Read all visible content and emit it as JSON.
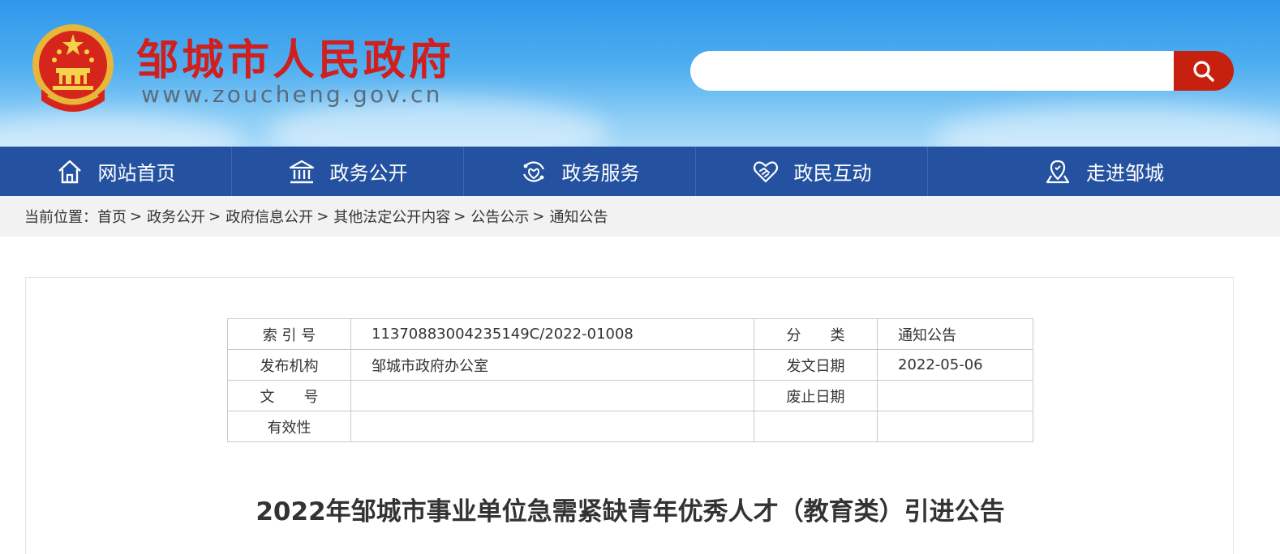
{
  "header": {
    "site_name": "邹城市人民政府",
    "site_url": "www.zoucheng.gov.cn",
    "search": {
      "value": "",
      "placeholder": ""
    },
    "colors": {
      "title": "#cf1f1f",
      "search_button": "#c8200f"
    }
  },
  "nav": {
    "background": "#2452a1",
    "items": [
      {
        "label": "网站首页",
        "icon": "home-icon"
      },
      {
        "label": "政务公开",
        "icon": "government-building-icon"
      },
      {
        "label": "政务服务",
        "icon": "service-icon"
      },
      {
        "label": "政民互动",
        "icon": "heart-hands-icon"
      },
      {
        "label": "走进邹城",
        "icon": "location-pin-icon"
      }
    ]
  },
  "breadcrumb": {
    "prefix": "当前位置：",
    "items": [
      "首页",
      "政务公开",
      "政府信息公开",
      "其他法定公开内容",
      "公告公示",
      "通知公告"
    ],
    "separator": ">"
  },
  "meta": {
    "rows": [
      {
        "k1": "索 引 号",
        "v1": "11370883004235149C/2022-01008",
        "k2": "分　　类",
        "v2": "通知公告"
      },
      {
        "k1": "发布机构",
        "v1": "邹城市政府办公室",
        "k2": "发文日期",
        "v2": "2022-05-06"
      },
      {
        "k1": "文　　号",
        "v1": "",
        "k2": "废止日期",
        "v2": ""
      },
      {
        "k1": "有效性",
        "v1": "",
        "k2": "",
        "v2": ""
      }
    ]
  },
  "article": {
    "title": "2022年邹城市事业单位急需紧缺青年优秀人才（教育类）引进公告"
  }
}
